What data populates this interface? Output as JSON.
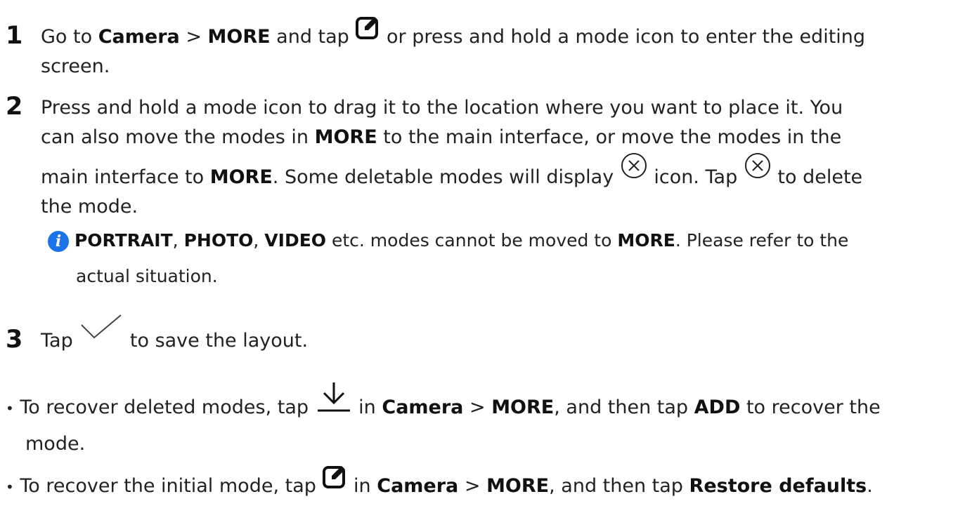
{
  "step1": {
    "num": "1",
    "a": "Go to ",
    "b_camera": "Camera",
    "c": " > ",
    "b_more": "MORE",
    "d": " and tap ",
    "e": " or press and hold a mode icon to enter the editing",
    "f": "screen."
  },
  "step2": {
    "num": "2",
    "l1": "Press and hold a mode icon to drag it to the location where you want to place it. You",
    "l2a": "can also move the modes in ",
    "l2b": "MORE",
    "l2c": " to the main interface, or move the modes in the",
    "l3a": "main interface to ",
    "l3b": "MORE",
    "l3c": ". Some deletable modes will display ",
    "l3d": " icon. Tap ",
    "l3e": " to delete",
    "l4": "the mode."
  },
  "note": {
    "portrait": "PORTRAIT",
    "sep1": ", ",
    "photo": "PHOTO",
    "sep2": ", ",
    "video": "VIDEO",
    "mid": " etc. modes cannot be moved to ",
    "more": "MORE",
    "end": ". Please refer to the",
    "l2": "actual situation."
  },
  "step3": {
    "num": "3",
    "a": "Tap ",
    "b": " to save the layout."
  },
  "bullet1": {
    "a": "To recover deleted modes, tap ",
    "b": " in ",
    "camera": "Camera",
    "c": " > ",
    "more": "MORE",
    "d": ", and then tap ",
    "add": "ADD",
    "e": " to recover the",
    "l2": "mode."
  },
  "bullet2": {
    "a": "To recover the initial mode, tap ",
    "b": " in ",
    "camera": "Camera",
    "c": " > ",
    "more": "MORE",
    "d": ", and then tap ",
    "restore": "Restore defaults",
    "e": "."
  },
  "icons": [
    "edit-icon",
    "close-circle-icon",
    "info-icon",
    "checkmark-icon",
    "download-icon"
  ],
  "colors": {
    "accent": "#1a73e8",
    "text": "#222222"
  }
}
